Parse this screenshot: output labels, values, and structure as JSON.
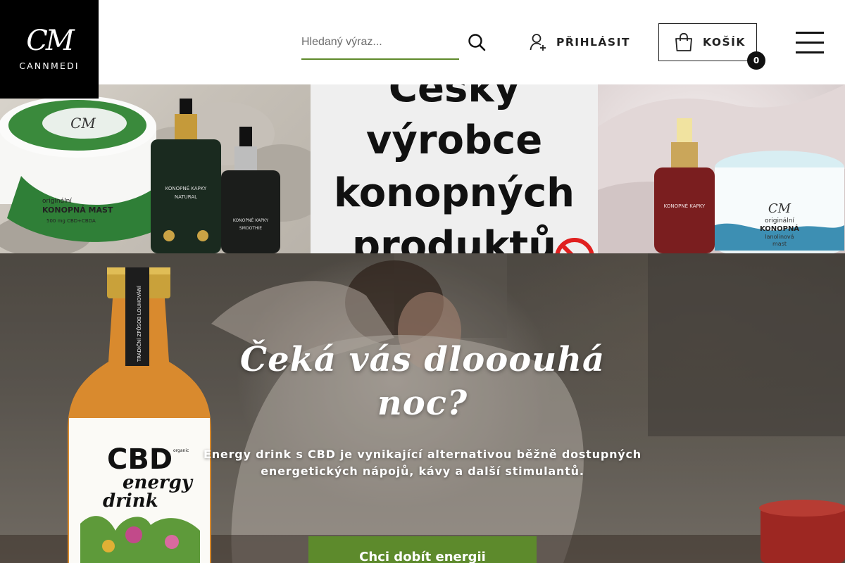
{
  "header": {
    "logo_mark": "CM",
    "logo_name": "CANNMEDI",
    "search": {
      "placeholder": "Hledaný výraz...",
      "value": "",
      "icon": "search-icon"
    },
    "login_label": "PŘIHLÁSIT",
    "login_icon": "user-add-icon",
    "cart_label": "KOŠÍK",
    "cart_icon": "shopping-bag-icon",
    "cart_count": "0",
    "menu_icon": "hamburger-menu-icon"
  },
  "banner": {
    "lines": [
      "Český",
      "výrobce",
      "konopných",
      "produktů"
    ],
    "left_photo": {
      "jar_lid_text": "CM",
      "jar_label_line1": "originální",
      "jar_label_line2": "KONOPNÁ MAST",
      "jar_label_line3": "500 mg CBD+CBDA",
      "bottle1_line1": "KONOPNÉ KAPKY",
      "bottle1_line2": "NATURAL",
      "bottle2_line1": "KONOPNÉ KAPKY",
      "bottle2_line2": "SMOOTHIE"
    },
    "right_photo": {
      "jar_line1": "originální",
      "jar_line2": "KONOPNÁ",
      "jar_line3": "lanolinová",
      "jar_line4": "mast",
      "bottle_label": "KONOPNÉ KAPKY"
    }
  },
  "hero": {
    "title": "Čeká vás dlooouhá noc?",
    "text": "Energy drink s CBD je vynikající alternativou běžně dostupných energetických nápojů, kávy a další stimulantů.",
    "cta_label": "Chci dobít energii",
    "bottle": {
      "neck_text": "TRADIČNÍ ZPŮSOB LOUHOVÁNÍ",
      "big": "CBD",
      "small_word": "organic",
      "line1": "energy",
      "line2": "drink"
    }
  },
  "colors": {
    "accent_green": "#5d8a2c",
    "search_underline": "#5f8a2b",
    "logo_bg": "#000000"
  }
}
